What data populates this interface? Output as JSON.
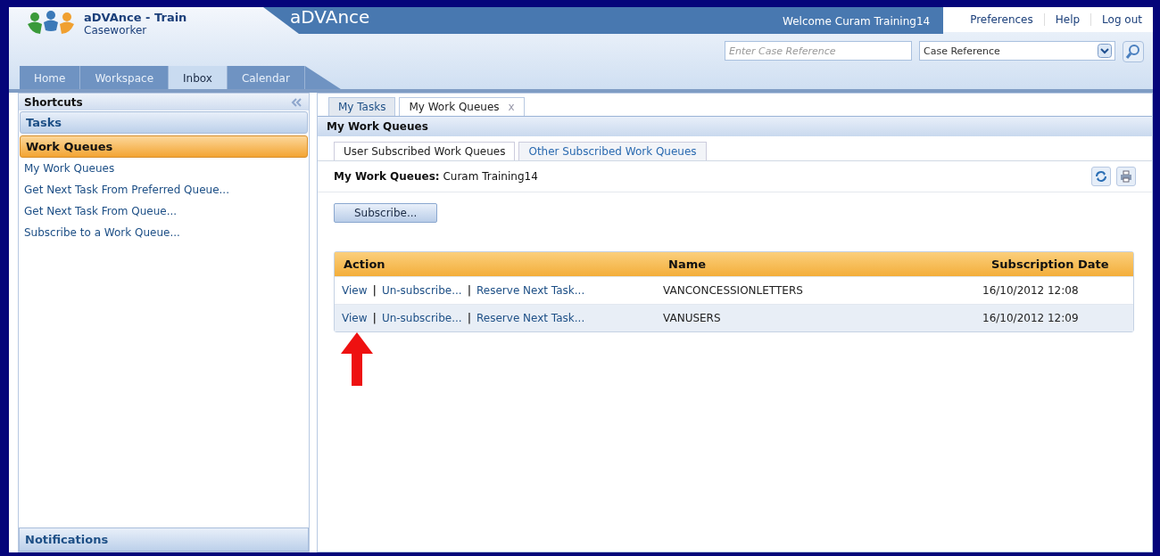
{
  "app": {
    "name": "aDVAnce - Train",
    "role": "Caseworker",
    "banner": "aDVAnce",
    "welcome": "Welcome Curam Training14"
  },
  "top_links": [
    "Preferences",
    "Help",
    "Log out"
  ],
  "search": {
    "placeholder": "Enter Case Reference",
    "type_value": "Case Reference"
  },
  "nav_tabs": [
    {
      "label": "Home",
      "selected": false
    },
    {
      "label": "Workspace",
      "selected": false
    },
    {
      "label": "Inbox",
      "selected": true
    },
    {
      "label": "Calendar",
      "selected": false
    }
  ],
  "sidebar": {
    "title": "Shortcuts",
    "sections": [
      {
        "label": "Tasks",
        "selected": false
      },
      {
        "label": "Work Queues",
        "selected": true
      }
    ],
    "items": [
      "My Work Queues",
      "Get Next Task From Preferred Queue...",
      "Get Next Task From Queue...",
      "Subscribe to a Work Queue..."
    ],
    "footer": "Notifications"
  },
  "page_tabs": [
    {
      "label": "My Tasks",
      "selected": false
    },
    {
      "label": "My Work Queues",
      "selected": true,
      "close": "x"
    }
  ],
  "page_title": "My Work Queues",
  "sub_tabs": [
    {
      "label": "User Subscribed Work Queues",
      "selected": true
    },
    {
      "label": "Other Subscribed Work Queues",
      "selected": false
    }
  ],
  "owner": {
    "label": "My Work Queues:",
    "value": "Curam Training14"
  },
  "subscribe_button": "Subscribe...",
  "table": {
    "columns": [
      "Action",
      "Name",
      "Subscription Date"
    ],
    "rows": [
      {
        "actions": [
          {
            "kind": "link",
            "label": "View"
          },
          {
            "kind": "separator",
            "label": "|"
          },
          {
            "kind": "link",
            "label": "Un-subscribe..."
          },
          {
            "kind": "separator",
            "label": "|"
          },
          {
            "kind": "link",
            "label": "Reserve Next Task..."
          }
        ],
        "name": "VANCONCESSIONLETTERS",
        "date": "16/10/2012 12:08"
      },
      {
        "actions": [
          {
            "kind": "link",
            "label": "View"
          },
          {
            "kind": "separator",
            "label": "|"
          },
          {
            "kind": "link",
            "label": "Un-subscribe..."
          },
          {
            "kind": "separator",
            "label": "|"
          },
          {
            "kind": "link",
            "label": "Reserve Next Task..."
          }
        ],
        "name": "VANUSERS",
        "date": "16/10/2012 12:09"
      }
    ]
  }
}
